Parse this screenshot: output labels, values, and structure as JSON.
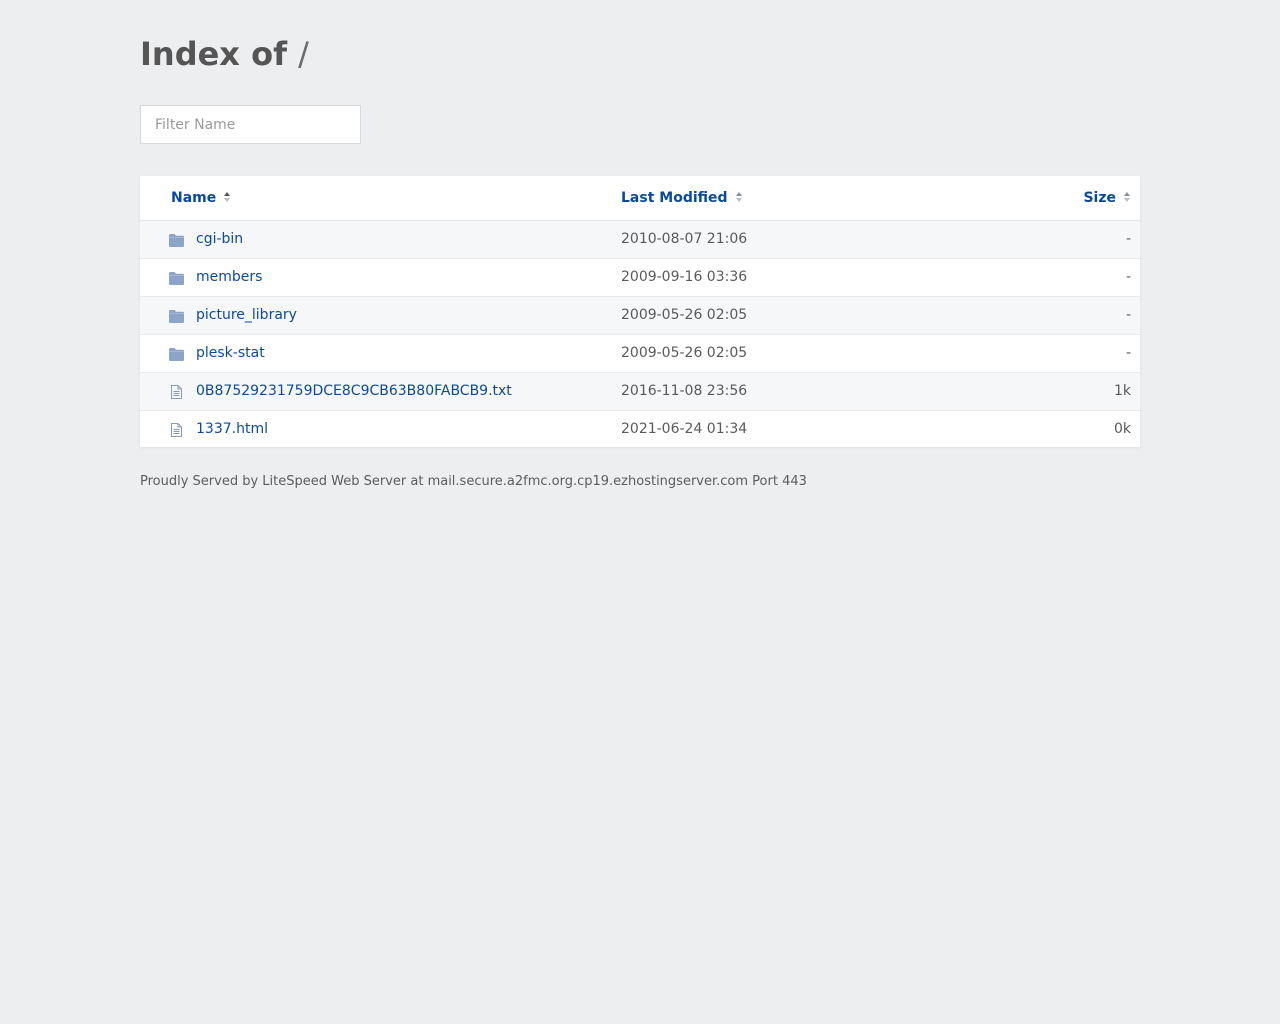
{
  "page": {
    "title": "Index of",
    "path": "/"
  },
  "filter": {
    "placeholder": "Filter Name",
    "value": ""
  },
  "table": {
    "columns": {
      "name": "Name",
      "modified": "Last Modified",
      "size": "Size"
    },
    "rows": [
      {
        "type": "folder",
        "name": "cgi-bin",
        "modified": "2010-08-07 21:06",
        "size": "-"
      },
      {
        "type": "folder",
        "name": "members",
        "modified": "2009-09-16 03:36",
        "size": "-"
      },
      {
        "type": "folder",
        "name": "picture_library",
        "modified": "2009-05-26 02:05",
        "size": "-"
      },
      {
        "type": "folder",
        "name": "plesk-stat",
        "modified": "2009-05-26 02:05",
        "size": "-"
      },
      {
        "type": "file",
        "name": "0B87529231759DCE8C9CB63B80FABCB9.txt",
        "modified": "2016-11-08 23:56",
        "size": "1k"
      },
      {
        "type": "file",
        "name": "1337.html",
        "modified": "2021-06-24 01:34",
        "size": "0k"
      }
    ]
  },
  "footer": {
    "text": "Proudly Served by LiteSpeed Web Server at mail.secure.a2fmc.org.cp19.ezhostingserver.com Port 443"
  },
  "colors": {
    "background": "#edeef0",
    "link": "#0a4a9e",
    "folder_icon": "#8ba4c8",
    "file_icon": "#8a9bb5"
  }
}
